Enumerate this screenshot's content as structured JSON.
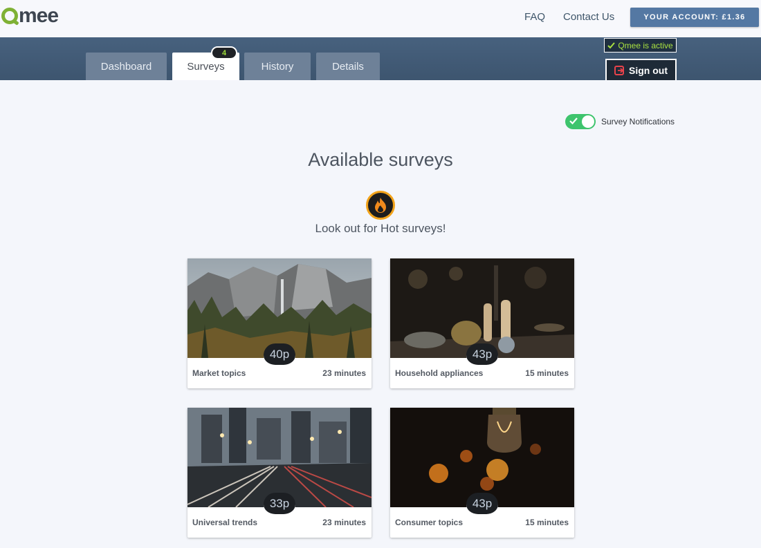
{
  "header": {
    "logo_text": "mee",
    "nav": {
      "faq": "FAQ",
      "contact": "Contact Us"
    },
    "account_button": "YOUR ACCOUNT: £1.36"
  },
  "tabs": [
    {
      "label": "Dashboard",
      "active": false
    },
    {
      "label": "Surveys",
      "active": true,
      "badge": "4"
    },
    {
      "label": "History",
      "active": false
    },
    {
      "label": "Details",
      "active": false
    }
  ],
  "status": {
    "active_label": "Qmee is active",
    "signout_label": "Sign out"
  },
  "notifications": {
    "label": "Survey Notifications",
    "enabled": true
  },
  "main": {
    "title": "Available surveys",
    "hot_text": "Look out for Hot surveys!"
  },
  "surveys": [
    {
      "name": "Market topics",
      "time": "23 minutes",
      "reward": "40p",
      "image": "mountain-forest"
    },
    {
      "name": "Household appliances",
      "time": "15 minutes",
      "reward": "43p",
      "image": "kitchen-objects"
    },
    {
      "name": "Universal trends",
      "time": "23 minutes",
      "reward": "33p",
      "image": "city-highway-night"
    },
    {
      "name": "Consumer topics",
      "time": "15 minutes",
      "reward": "43p",
      "image": "light-bulb-bokeh"
    }
  ],
  "colors": {
    "accent_green": "#7fb135",
    "header_band": "#415a75",
    "account_button": "#5478a3",
    "toggle_on": "#3ec46d",
    "hot_ring": "#f2a31a"
  }
}
